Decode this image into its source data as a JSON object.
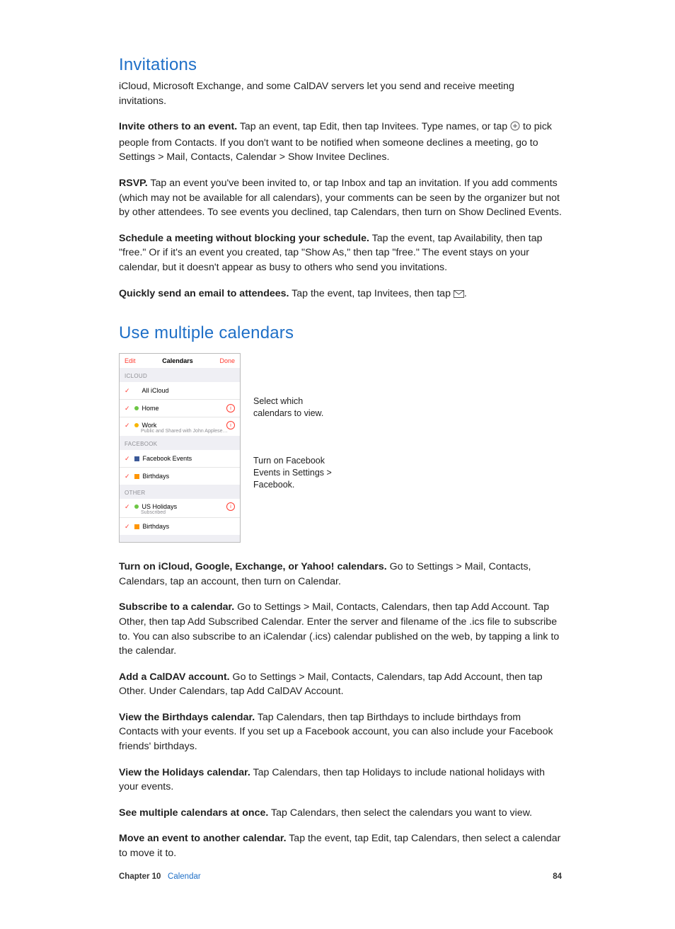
{
  "section1": {
    "heading": "Invitations",
    "intro": "iCloud, Microsoft Exchange, and some CalDAV servers let you send and receive meeting invitations.",
    "p_invite_bold": "Invite others to an event.",
    "p_invite_pre": " Tap an event, tap Edit, then tap Invitees. Type names, or tap ",
    "p_invite_post": " to pick people from Contacts. If you don't want to be notified when someone declines a meeting, go to Settings > Mail, Contacts, Calendar > Show Invitee Declines.",
    "p_rsvp_bold": "RSVP.",
    "p_rsvp_body": " Tap an event you've been invited to, or tap Inbox and tap an invitation. If you add comments (which may not be available for all calendars), your comments can be seen by the organizer but not by other attendees. To see events you declined, tap Calendars, then turn on Show Declined Events.",
    "p_schedule_bold": "Schedule a meeting without blocking your schedule.",
    "p_schedule_body": " Tap the event, tap Availability, then tap \"free.\" Or if it's an event you created, tap \"Show As,\" then tap \"free.\" The event stays on your calendar, but it doesn't appear as busy to others who send you invitations.",
    "p_email_bold": "Quickly send an email to attendees.",
    "p_email_pre": " Tap the event, tap Invitees, then tap ",
    "p_email_post": "."
  },
  "section2": {
    "heading": "Use multiple calendars",
    "phone": {
      "edit": "Edit",
      "title": "Calendars",
      "done": "Done",
      "group1": "ICLOUD",
      "all_icloud": "All iCloud",
      "home": "Home",
      "work": "Work",
      "work_sub": "Public and Shared with John Applese…",
      "group2": "FACEBOOK",
      "fb_events": "Facebook Events",
      "birthdays": "Birthdays",
      "group3": "OTHER",
      "us_holidays": "US Holidays",
      "us_sub": "Subscribed",
      "other_birthdays": "Birthdays"
    },
    "callout1": "Select which\ncalendars to view.",
    "callout2": "Turn on Facebook\nEvents in Settings >\nFacebook.",
    "p_turnon_bold": "Turn on iCloud, Google, Exchange, or Yahoo! calendars.",
    "p_turnon_body": " Go to Settings > Mail, Contacts, Calendars, tap an account, then turn on Calendar.",
    "p_sub_bold": "Subscribe to a calendar.",
    "p_sub_body": " Go to Settings > Mail, Contacts, Calendars, then tap Add Account. Tap Other, then tap Add Subscribed Calendar. Enter the server and filename of the .ics file to subscribe to. You can also subscribe to an iCalendar (.ics) calendar published on the web, by tapping a link to the calendar.",
    "p_caldav_bold": "Add a CalDAV account.",
    "p_caldav_body": " Go to Settings > Mail, Contacts, Calendars, tap Add Account, then tap Other. Under Calendars, tap Add CalDAV Account.",
    "p_bday_bold": "View the Birthdays calendar.",
    "p_bday_body": " Tap Calendars, then tap Birthdays to include birthdays from Contacts with your events. If you set up a Facebook account, you can also include your Facebook friends' birthdays.",
    "p_hol_bold": "View the Holidays calendar.",
    "p_hol_body": " Tap Calendars, then tap Holidays to include national holidays with your events.",
    "p_multi_bold": "See multiple calendars at once.",
    "p_multi_body": " Tap Calendars, then select the calendars you want to view.",
    "p_move_bold": "Move an event to another calendar.",
    "p_move_body": " Tap the event, tap Edit, tap Calendars, then select a calendar to move it to."
  },
  "footer": {
    "chapter_label": "Chapter  10",
    "chapter_title": "Calendar",
    "page": "84"
  }
}
